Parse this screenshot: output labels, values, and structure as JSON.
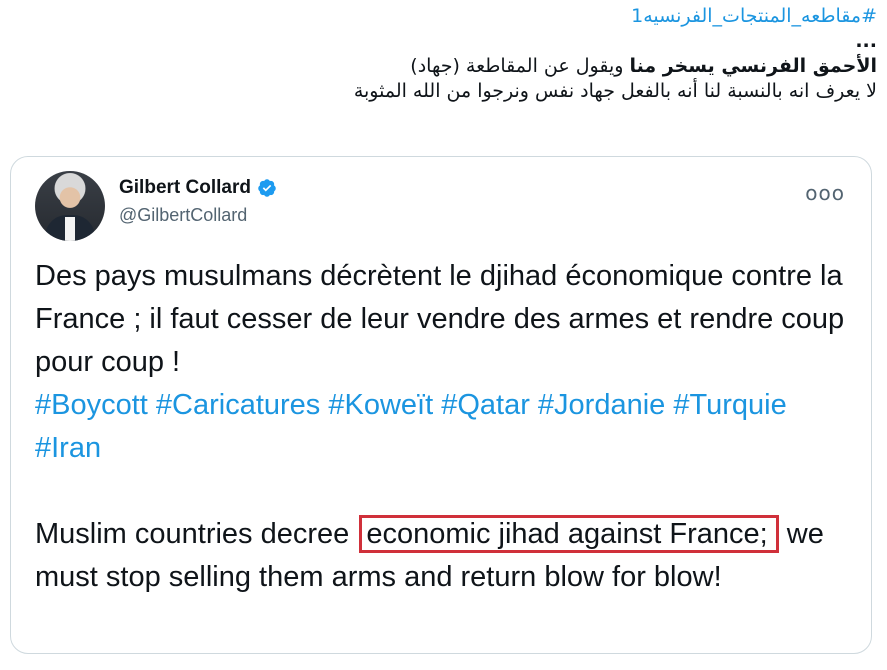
{
  "post": {
    "hashtag": "#مقاطعه_المنتجات_الفرنسيه1",
    "ellipsis": "...",
    "line1_bold": "الأحمق الفرنسي يسخر منا",
    "line1_rest": " ويقول عن المقاطعة (جهاد)",
    "line2": "لا يعرف انه بالنسبة لنا أنه بالفعل جهاد نفس ونرجوا من الله المثوبة"
  },
  "embedded_tweet": {
    "author_name": "Gilbert Collard",
    "handle": "@GilbertCollard",
    "more_glyph": "ooo",
    "french_text": "Des pays musulmans décrètent le djihad économique contre la France ; il faut cesser de leur vendre des armes et rendre coup pour coup !",
    "french_hashtags": "#Boycott #Caricatures #Koweït #Qatar #Jordanie #Turquie #Iran",
    "english_before": "Muslim countries decree ",
    "english_highlight": "economic jihad against France;",
    "english_after": " we must stop selling them arms and return blow for blow!"
  },
  "colors": {
    "link": "#1b95e0",
    "verified": "#1d9bf0",
    "highlight_box": "#d0303a",
    "card_border": "#cfd9de"
  },
  "icons": [
    "verified-badge-icon",
    "more-options-icon",
    "avatar"
  ]
}
